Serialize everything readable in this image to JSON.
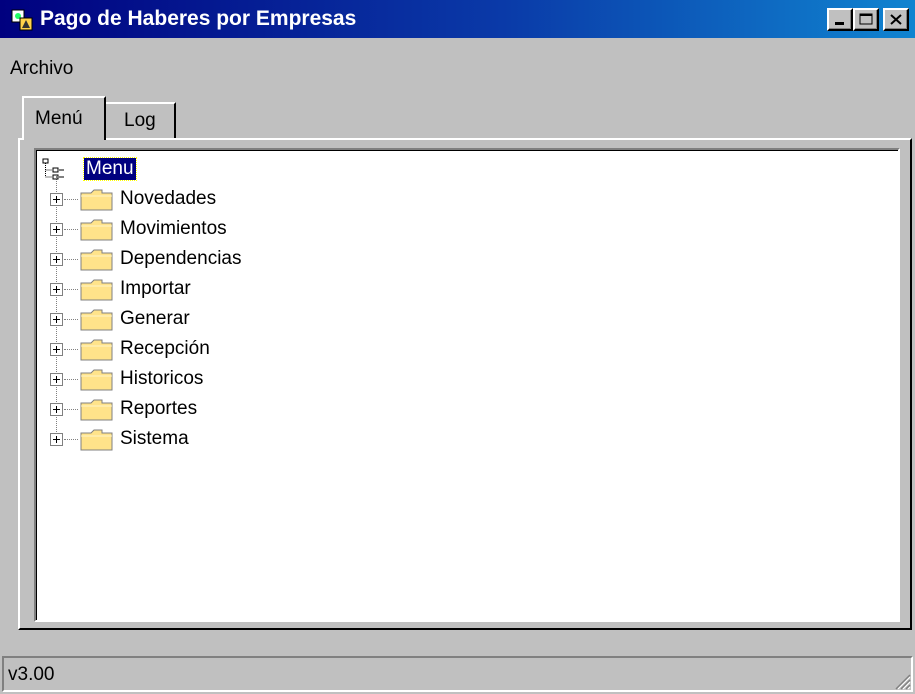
{
  "window": {
    "title": "Pago de Haberes por Empresas",
    "icon": "app-icon",
    "controls": [
      "minimize",
      "maximize",
      "close"
    ]
  },
  "menubar": {
    "items": [
      {
        "label": "Archivo"
      }
    ]
  },
  "tabs": [
    {
      "label": "Menú",
      "selected": true
    },
    {
      "label": "Log",
      "selected": false
    }
  ],
  "tree": {
    "root": {
      "label": "Menu",
      "icon": "tree-root-icon",
      "selected": true
    },
    "nodes": [
      {
        "label": "Novedades",
        "icon": "folder-icon",
        "expandable": true
      },
      {
        "label": "Movimientos",
        "icon": "folder-icon",
        "expandable": true
      },
      {
        "label": "Dependencias",
        "icon": "folder-icon",
        "expandable": true
      },
      {
        "label": "Importar",
        "icon": "folder-icon",
        "expandable": true
      },
      {
        "label": "Generar",
        "icon": "folder-icon",
        "expandable": true
      },
      {
        "label": "Recepción",
        "icon": "folder-icon",
        "expandable": true
      },
      {
        "label": "Historicos",
        "icon": "folder-icon",
        "expandable": true
      },
      {
        "label": "Reportes",
        "icon": "folder-icon",
        "expandable": true
      },
      {
        "label": "Sistema",
        "icon": "folder-icon",
        "expandable": true
      }
    ]
  },
  "statusbar": {
    "text": "v3.00"
  },
  "colors": {
    "titlebar_start": "#00007f",
    "titlebar_end": "#1084d0",
    "face": "#c0c0c0",
    "selection": "#00007f",
    "folder": "#ffe38a"
  }
}
